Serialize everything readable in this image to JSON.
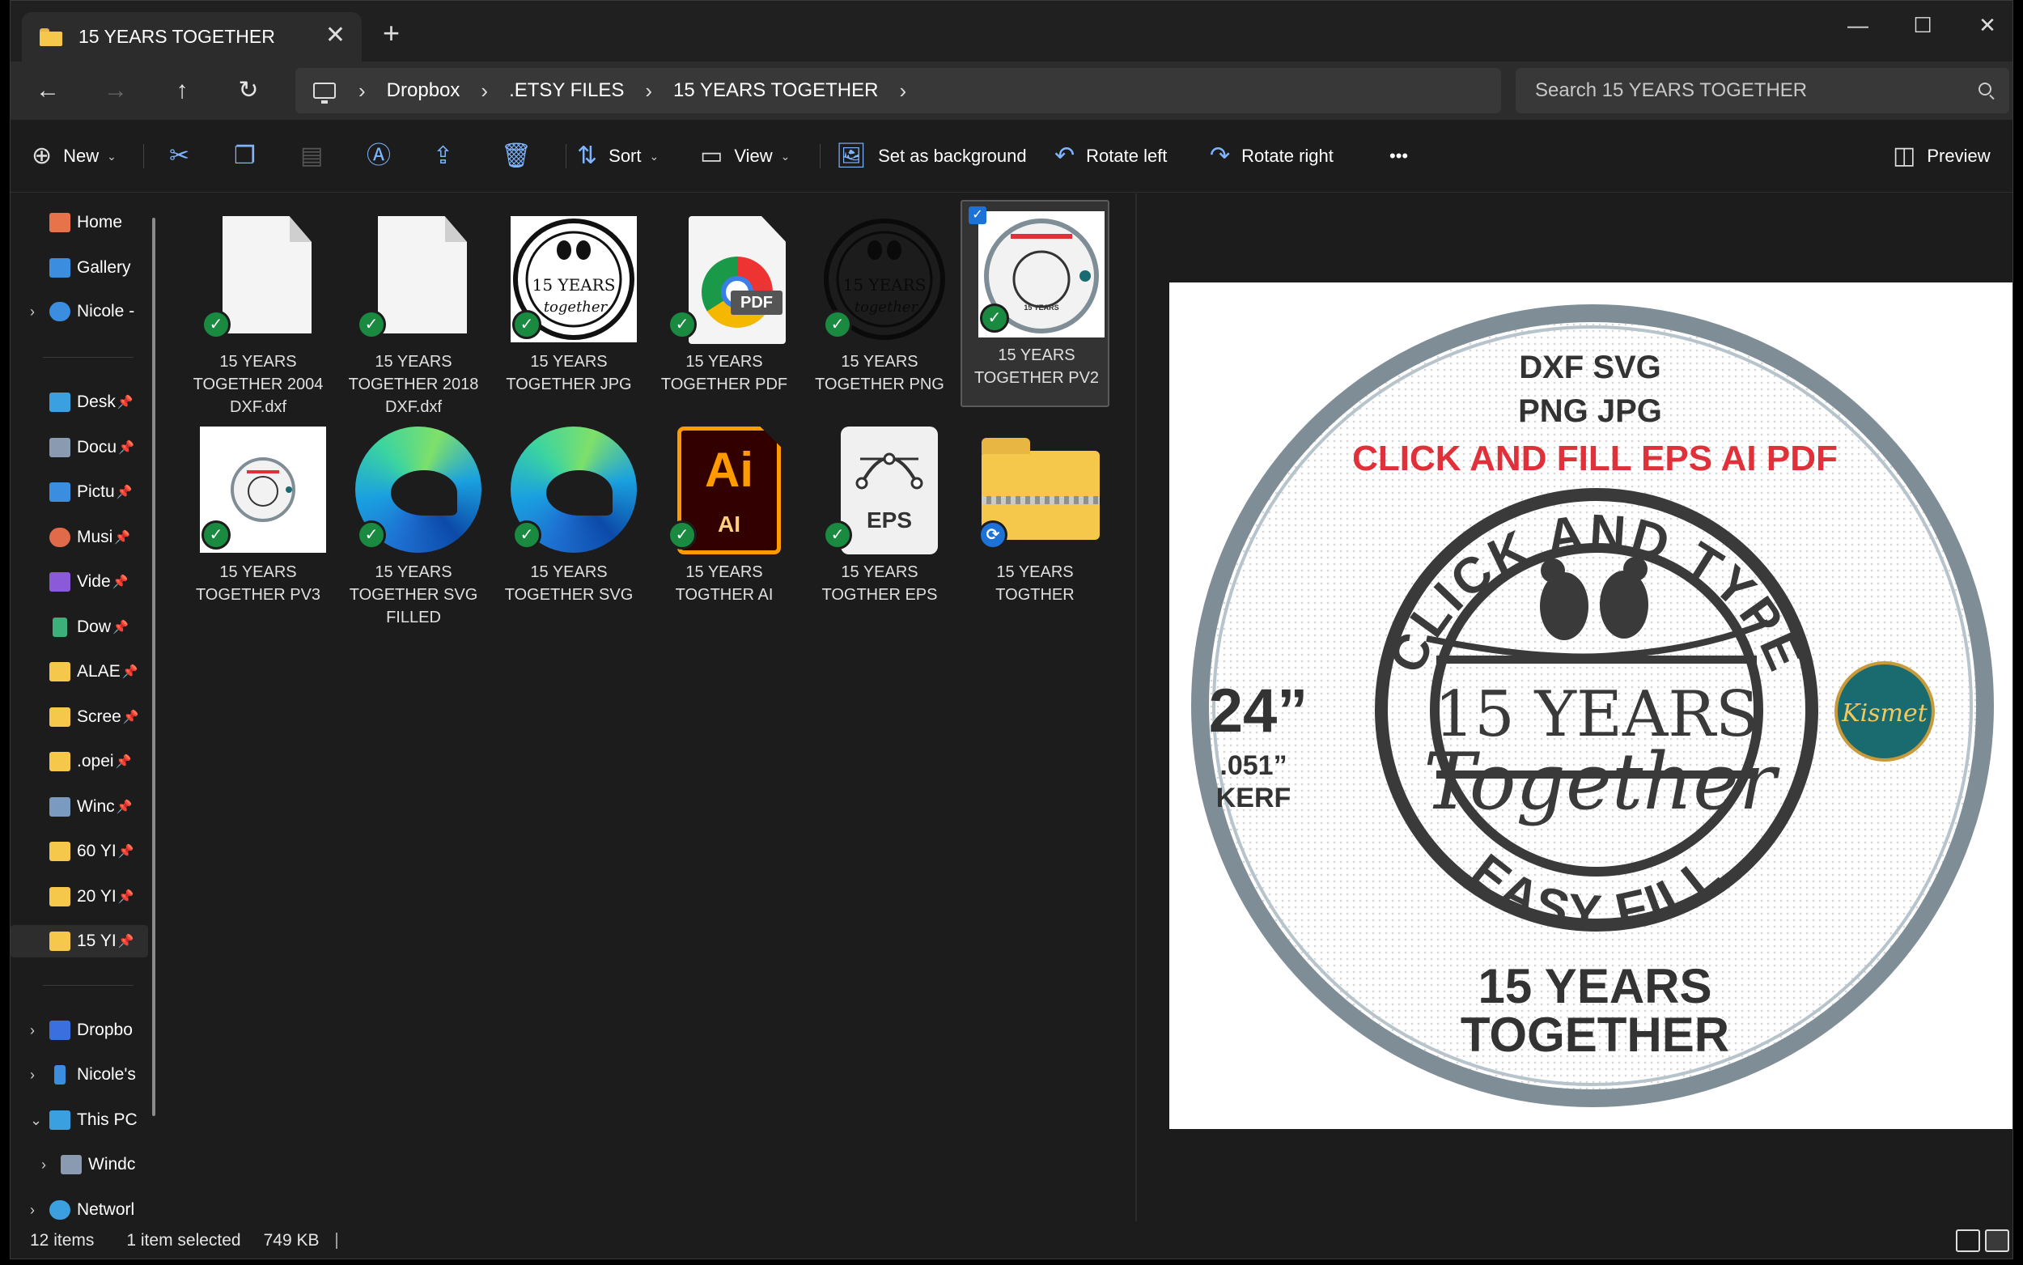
{
  "window": {
    "tab_title": "15 YEARS TOGETHER",
    "close_tab": "✕",
    "new_tab": "+",
    "minimize": "—",
    "maximize": "☐",
    "close": "✕"
  },
  "nav": {
    "back": "←",
    "forward": "→",
    "up": "↑",
    "refresh": "↻"
  },
  "breadcrumb": [
    "Dropbox",
    ".ETSY FILES",
    "15 YEARS TOGETHER"
  ],
  "breadcrumb_sep": "›",
  "search": {
    "placeholder": "Search 15 YEARS TOGETHER"
  },
  "toolbar": {
    "new_label": "New",
    "sort_label": "Sort",
    "view_label": "View",
    "set_background_label": "Set as background",
    "rotate_left_label": "Rotate left",
    "rotate_right_label": "Rotate right",
    "more_label": "•••",
    "preview_label": "Preview"
  },
  "sidebar": {
    "items": [
      {
        "label": "Home",
        "icon": "home-icon",
        "color": "#e8734a"
      },
      {
        "label": "Gallery",
        "icon": "gallery-icon",
        "color": "#3b8de0"
      },
      {
        "label": "Nicole -",
        "icon": "onedrive-icon",
        "color": "#3b8de0"
      },
      {
        "label": "Desk",
        "icon": "desktop-icon",
        "color": "#3ba0e0"
      },
      {
        "label": "Docu",
        "icon": "documents-icon",
        "color": "#8a9ab0"
      },
      {
        "label": "Pictu",
        "icon": "pictures-icon",
        "color": "#3b8de0"
      },
      {
        "label": "Musi",
        "icon": "music-icon",
        "color": "#e06a4a"
      },
      {
        "label": "Vide",
        "icon": "videos-icon",
        "color": "#8a5ad8"
      },
      {
        "label": "Dow",
        "icon": "downloads-icon",
        "color": "#3cb07a"
      },
      {
        "label": "ALAE",
        "icon": "folder-icon",
        "color": "#f5c84c"
      },
      {
        "label": "Scree",
        "icon": "folder-icon",
        "color": "#f5c84c"
      },
      {
        "label": ".opei",
        "icon": "folder-icon",
        "color": "#f5c84c"
      },
      {
        "label": "Winc",
        "icon": "folder-icon",
        "color": "#7a9ac0"
      },
      {
        "label": "60 YI",
        "icon": "folder-icon",
        "color": "#f5c84c"
      },
      {
        "label": "20 YI",
        "icon": "folder-icon",
        "color": "#f5c84c"
      },
      {
        "label": "15 YI",
        "icon": "folder-icon",
        "color": "#f5c84c"
      },
      {
        "label": "Dropbo",
        "icon": "dropbox-icon",
        "color": "#3b6fe0"
      },
      {
        "label": "Nicole's",
        "icon": "phone-icon",
        "color": "#3b8de0"
      },
      {
        "label": "This PC",
        "icon": "pc-icon",
        "color": "#3ba0e0"
      },
      {
        "label": "Windc",
        "icon": "drive-icon",
        "color": "#8a9ab0"
      },
      {
        "label": "Networl",
        "icon": "network-icon",
        "color": "#3ba0e0"
      }
    ]
  },
  "files": [
    {
      "line1": "15 YEARS",
      "line2": "TOGETHER 2004",
      "line3": "DXF.dxf",
      "kind": "doc",
      "status": "synced"
    },
    {
      "line1": "15 YEARS",
      "line2": "TOGETHER 2018",
      "line3": "DXF.dxf",
      "kind": "doc",
      "status": "synced"
    },
    {
      "line1": "15 YEARS",
      "line2": "TOGETHER JPG",
      "line3": "",
      "kind": "image",
      "status": "synced"
    },
    {
      "line1": "15 YEARS",
      "line2": "TOGETHER PDF",
      "line3": "",
      "kind": "pdf",
      "status": "synced"
    },
    {
      "line1": "15 YEARS",
      "line2": "TOGETHER PNG",
      "line3": "",
      "kind": "png",
      "status": "synced"
    },
    {
      "line1": "15 YEARS",
      "line2": "TOGETHER PV2",
      "line3": "",
      "kind": "image",
      "status": "synced"
    },
    {
      "line1": "15 YEARS",
      "line2": "TOGETHER PV3",
      "line3": "",
      "kind": "image",
      "status": "synced"
    },
    {
      "line1": "15 YEARS",
      "line2": "TOGETHER SVG",
      "line3": "FILLED",
      "kind": "edge",
      "status": "synced"
    },
    {
      "line1": "15 YEARS",
      "line2": "TOGETHER SVG",
      "line3": "",
      "kind": "edge",
      "status": "synced"
    },
    {
      "line1": "15 YEARS",
      "line2": "TOGTHER AI",
      "line3": "",
      "kind": "ai",
      "status": "synced"
    },
    {
      "line1": "15 YEARS",
      "line2": "TOGTHER EPS",
      "line3": "",
      "kind": "eps",
      "status": "synced"
    },
    {
      "line1": "15 YEARS",
      "line2": "TOGTHER",
      "line3": "",
      "kind": "zip",
      "status": "syncing"
    }
  ],
  "thumb_text": {
    "pdf": "PDF",
    "ai": "Ai",
    "ai_small": "AI",
    "eps": "EPS",
    "mini_years": "15 YEARS",
    "mini_script": "together",
    "check": "✓",
    "sync": "⟳"
  },
  "preview": {
    "line1": "DXF SVG",
    "line2": "PNG JPG",
    "line3": "CLICK AND FILL EPS AI PDF",
    "size": "24”",
    "kerf_size": ".051”",
    "kerf": "KERF",
    "arc_top": "CLICK AND TYPE",
    "center_years": "15 YEARS",
    "center_script": "Together",
    "arc_bottom": "EASY FILL",
    "footer1": "15 YEARS",
    "footer2": "TOGETHER",
    "logo": "Kismet",
    "accent": "#e0303a",
    "ring_color": "#7f8d96"
  },
  "status": {
    "items": "12 items",
    "selected": "1 item selected",
    "size": "749 KB"
  }
}
